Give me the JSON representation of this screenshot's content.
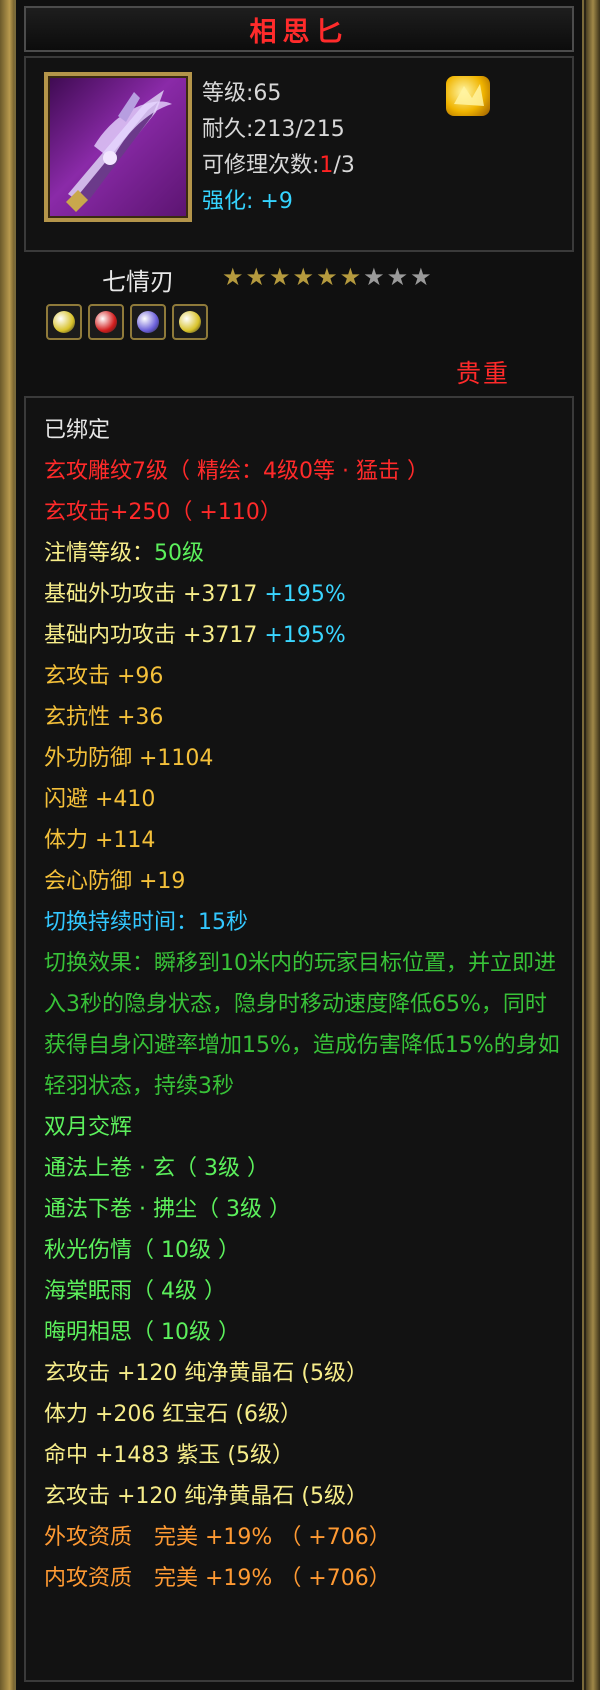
{
  "colors": {
    "title": "#ff2b2b",
    "rarity": "#ff2a2a",
    "star_filled": "#b59a3e",
    "star_empty": "#9a9a9a"
  },
  "header": {
    "title": "相思匕"
  },
  "item": {
    "level": "等级:65",
    "durability": "耐久:213/215",
    "repair_prefix": "可修理次数:",
    "repair_used": "1",
    "repair_total": "/3",
    "enhance_label": "强化:",
    "enhance_value": "+9",
    "type_name": "七情刃",
    "stars_filled": 6,
    "stars_total": 9,
    "rarity": "贵重",
    "gems": [
      {
        "icon": "yellow-gem-icon",
        "color": "#d8c22a"
      },
      {
        "icon": "red-gem-icon",
        "color": "#d21c1c"
      },
      {
        "icon": "purple-gem-icon",
        "color": "#6a5ed8"
      },
      {
        "icon": "yellow-gem-icon",
        "color": "#d8c22a"
      }
    ]
  },
  "attributes": {
    "bound": "已绑定",
    "engrave": "玄攻雕纹7级（ 精绘：4级0等 · 猛击 ）",
    "xuan_atk_bonus": "玄攻击+250（ +110）",
    "devotion_label": "注情等级：",
    "devotion_value": "50级",
    "base_outer_label": "基础外功攻击 +3717",
    "base_outer_pct": "+195%",
    "base_inner_label": "基础内功攻击 +3717",
    "base_inner_pct": "+195%",
    "stat_xuan_atk": "玄攻击 +96",
    "stat_xuan_res": "玄抗性 +36",
    "stat_outer_def": "外功防御 +1104",
    "stat_dodge": "闪避 +410",
    "stat_stamina": "体力 +114",
    "stat_crit_def": "会心防御 +19",
    "switch_duration": "切换持续时间：15秒",
    "switch_effect": "切换效果：瞬移到10米内的玩家目标位置，并立即进入3秒的隐身状态，隐身时移动速度降低65%，同时获得自身闪避率增加15%，造成伤害降低15%的身如轻羽状态，持续3秒",
    "set_name": "双月交辉",
    "set_items": [
      "通法上卷 · 玄（ 3级 ）",
      "通法下卷 · 拂尘（ 3级 ）",
      "秋光伤情（ 10级 ）",
      "海棠眠雨（ 4级 ）",
      "晦明相思（ 10级 ）"
    ],
    "gem_stats": [
      "玄攻击 +120 纯净黄晶石 (5级）",
      "体力 +206 红宝石 (6级）",
      "命中 +1483 紫玉 (5级）",
      "玄攻击 +120 纯净黄晶石 (5级）"
    ],
    "quality": [
      "外攻资质　完美 +19% （ +706）",
      "内攻资质　完美 +19% （ +706）"
    ]
  }
}
